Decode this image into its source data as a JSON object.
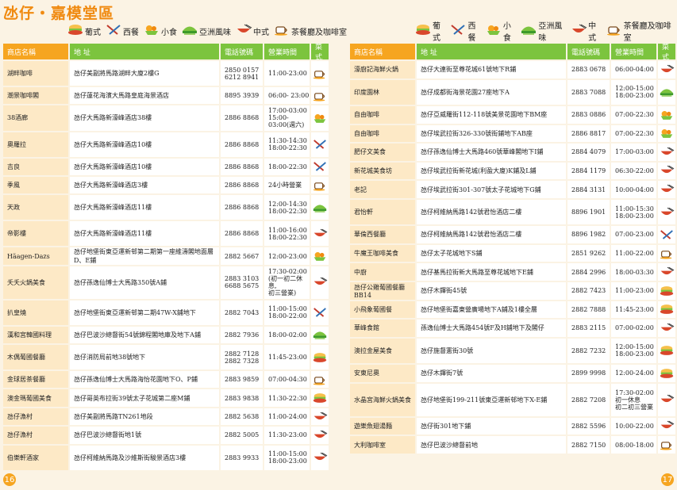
{
  "title": "氹仔・嘉模堂區",
  "legend": [
    {
      "icon": "portuguese",
      "label": "葡式"
    },
    {
      "icon": "western",
      "label": "西餐"
    },
    {
      "icon": "snack",
      "label": "小食"
    },
    {
      "icon": "asian",
      "label": "亞洲風味"
    },
    {
      "icon": "chinese",
      "label": "中式"
    },
    {
      "icon": "cafe",
      "label": "茶餐廳及咖啡室"
    }
  ],
  "headers": {
    "name": "商店名稱",
    "address": "地 址",
    "tel": "電話號碼",
    "hours": "營業時間",
    "category": "菜式"
  },
  "colors": {
    "header_green": "#7cc43e",
    "header_orange": "#f6a520",
    "name_cell": "#fde9c6",
    "title": "#f08a10"
  },
  "left_page": {
    "page_number": "16",
    "rows": [
      {
        "name": "湖畔咖啡",
        "address": "氹仔美副將馬路湖畔大廈2樓G",
        "tel": "2850 0157\n6212 8941",
        "hours": "11:00-23:00",
        "category": "cafe"
      },
      {
        "name": "潮景咖啡閣",
        "address": "氹仔蓮花海濱大馬路皇庭海景酒店",
        "tel": "8895 3939",
        "hours": "06:00- 23:00",
        "category": "cafe"
      },
      {
        "name": "38酒廊",
        "address": "氹仔大馬路新濠峰酒店38樓",
        "tel": "2886 8868",
        "hours": "17:00-03:00\n15:00-03:00(週六)",
        "category": "snack"
      },
      {
        "name": "奧羅拉",
        "address": "氹仔大馬路新濠峰酒店10樓",
        "tel": "2886 8868",
        "hours": "11:30-14:30\n18:00-22:30",
        "category": "western"
      },
      {
        "name": "吉良",
        "address": "氹仔大馬路新濠峰酒店10樓",
        "tel": "2886 8868",
        "hours": "18:00-22:30",
        "category": "western"
      },
      {
        "name": "季風",
        "address": "氹仔大馬路新濠峰酒店3樓",
        "tel": "2886 8868",
        "hours": "24小時營業",
        "category": "cafe"
      },
      {
        "name": "天政",
        "address": "氹仔大馬路新濠峰酒店11樓",
        "tel": "2886 8868",
        "hours": "12:00-14:30\n18:00-22:30",
        "category": "asian"
      },
      {
        "name": "帝影樓",
        "address": "氹仔大馬路新濠峰酒店11樓",
        "tel": "2886 8868",
        "hours": "11:00-16:00\n18:00-22:30",
        "category": "chinese"
      },
      {
        "name": "Häagen-Dazs",
        "address": "氹仔地堡街東亞運新邨第二期第一座維濤閣地面層D、E鋪",
        "tel": "2882 5667",
        "hours": "12:00-23:00",
        "category": "snack"
      },
      {
        "name": "夭夭火鍋美食",
        "address": "氹仔孫逸仙博士大馬路350號A鋪",
        "tel": "2883 3103\n6688 5675",
        "hours": "17:30-02:00\n(初一初二休息,\n初三營業)",
        "category": "chinese"
      },
      {
        "name": "扒皇燒",
        "address": "氹仔地堡街東亞運新邨第二期47W-X鋪地下",
        "tel": "2882 7043",
        "hours": "11:00-15:00\n18:00-22:00",
        "category": "western"
      },
      {
        "name": "漢和宮韓國料理",
        "address": "氹仔巴波沙總督街54號錦程閣地庫及地下A鋪",
        "tel": "2882 7936",
        "hours": "18:00-02:00",
        "category": "asian"
      },
      {
        "name": "木偶葡國餐廳",
        "address": "氹仔消防局前地38號地下",
        "tel": "2882 7128\n2882 7328",
        "hours": "11:45-23:00",
        "category": "portuguese"
      },
      {
        "name": "金球居茶餐廳",
        "address": "氹仔孫逸仙博士大馬路海怡花園地下O、P鋪",
        "tel": "2883 9859",
        "hours": "07:00-04:30",
        "category": "cafe"
      },
      {
        "name": "澳金瑪葡國美食",
        "address": "氹仔哥英布拉街39號太子花城第二座M鋪",
        "tel": "2883 9838",
        "hours": "11:30-22:30",
        "category": "portuguese"
      },
      {
        "name": "氹仔漁村",
        "address": "氹仔美副將馬路TN261地段",
        "tel": "2882 5638",
        "hours": "11:00-24:00",
        "category": "chinese"
      },
      {
        "name": "氹仔漁村",
        "address": "氹仔巴波沙總督街地1號",
        "tel": "2882 5005",
        "hours": "11:30-23:00",
        "category": "chinese"
      },
      {
        "name": "伯樂軒酒家",
        "address": "氹仔柯維納馬路及沙維斯街駿景酒店3樓",
        "tel": "2883 9933",
        "hours": "11:00-15:00\n18:00-23:00",
        "category": "chinese"
      }
    ]
  },
  "right_page": {
    "page_number": "17",
    "rows": [
      {
        "name": "濠廚記海鮮火鍋",
        "address": "氹仔大連街至尊花城61號地下R鋪",
        "tel": "2883 0678",
        "hours": "06:00-04:00",
        "category": "chinese"
      },
      {
        "name": "印度園林",
        "address": "氹仔成都街海景花園27座地下A",
        "tel": "2883 7088",
        "hours": "12:00-15:00\n18:00-23:00",
        "category": "asian"
      },
      {
        "name": "自由咖啡",
        "address": "氹仔亞威羅街112-118號美景花園地下BM座",
        "tel": "2883 0886",
        "hours": "07:00-22:30",
        "category": "snack"
      },
      {
        "name": "自由咖啡",
        "address": "氹仔埃武拉街326-330號街鋪地下AB座",
        "tel": "2886 8817",
        "hours": "07:00-22:30",
        "category": "snack"
      },
      {
        "name": "肥仔文美食",
        "address": "氹仔孫逸仙博士大馬路460號華峰閣地下I鋪",
        "tel": "2884 4079",
        "hours": "17:00-03:00",
        "category": "chinese"
      },
      {
        "name": "新花城美食坊",
        "address": "氹仔埃武拉街新花城(利盈大廈)K鋪及L鋪",
        "tel": "2884 1179",
        "hours": "06:30-22:00",
        "category": "chinese"
      },
      {
        "name": "老記",
        "address": "氹仔埃武拉街301-307號太子花城地下G鋪",
        "tel": "2884 3131",
        "hours": "10:00-04:00",
        "category": "chinese"
      },
      {
        "name": "君怡軒",
        "address": "氹仔柯維納馬路142號君怡酒店二樓",
        "tel": "8896 1901",
        "hours": "11:00-15:30\n18:00-23:00",
        "category": "chinese"
      },
      {
        "name": "華倫西餐廳",
        "address": "氹仔柯維納馬路142號君怡酒店二樓",
        "tel": "8896 1982",
        "hours": "07:00-23:00",
        "category": "western"
      },
      {
        "name": "牛魔王咖啡美食",
        "address": "氹仔太子花城地下S鋪",
        "tel": "2851 9262",
        "hours": "11:00-22:00",
        "category": "cafe"
      },
      {
        "name": "中廚",
        "address": "氹仔基馬拉街新大馬路至尊花城地下E鋪",
        "tel": "2884 2996",
        "hours": "18:00-03:30",
        "category": "chinese"
      },
      {
        "name": "氹仔公雞葡國餐廳 BB14",
        "address": "氹仔木鐸街45號",
        "tel": "2882 7423",
        "hours": "11:00-23:00",
        "category": "portuguese"
      },
      {
        "name": "小飛象葡國餐",
        "address": "氹仔地堡街嘉東營廣場地下A鋪及1樓全層",
        "tel": "2882 7888",
        "hours": "11:45-23:00",
        "category": "portuguese"
      },
      {
        "name": "華峰食館",
        "address": "孫逸仙博士大馬路454號F及H鋪地下及閣仔",
        "tel": "2883 2115",
        "hours": "07:00-02:00",
        "category": "chinese"
      },
      {
        "name": "澳拉金屋美食",
        "address": "氹仔施督憲街30號",
        "tel": "2882 7232",
        "hours": "12:00-15:00\n18:00-23:00",
        "category": "portuguese"
      },
      {
        "name": "安東尼奧",
        "address": "氹仔木鐸街7號",
        "tel": "2899 9998",
        "hours": "12:00-24:00",
        "category": "portuguese"
      },
      {
        "name": "水晶宮海鮮火鍋美食",
        "address": "氹仔地堡街199-211號東亞運新邨地下X-E鋪",
        "tel": "2882 7208",
        "hours": "17:30-02:00\n初一休息\n初二初三營業",
        "category": "chinese"
      },
      {
        "name": "遊樂魚翅湯麵",
        "address": "氹仔街301地下鋪",
        "tel": "2882 5596",
        "hours": "10:00-22:00",
        "category": "chinese"
      },
      {
        "name": "大利咖啡室",
        "address": "氹仔巴波沙總督前地",
        "tel": "2882 7150",
        "hours": "08:00-18:00",
        "category": "cafe"
      }
    ]
  }
}
